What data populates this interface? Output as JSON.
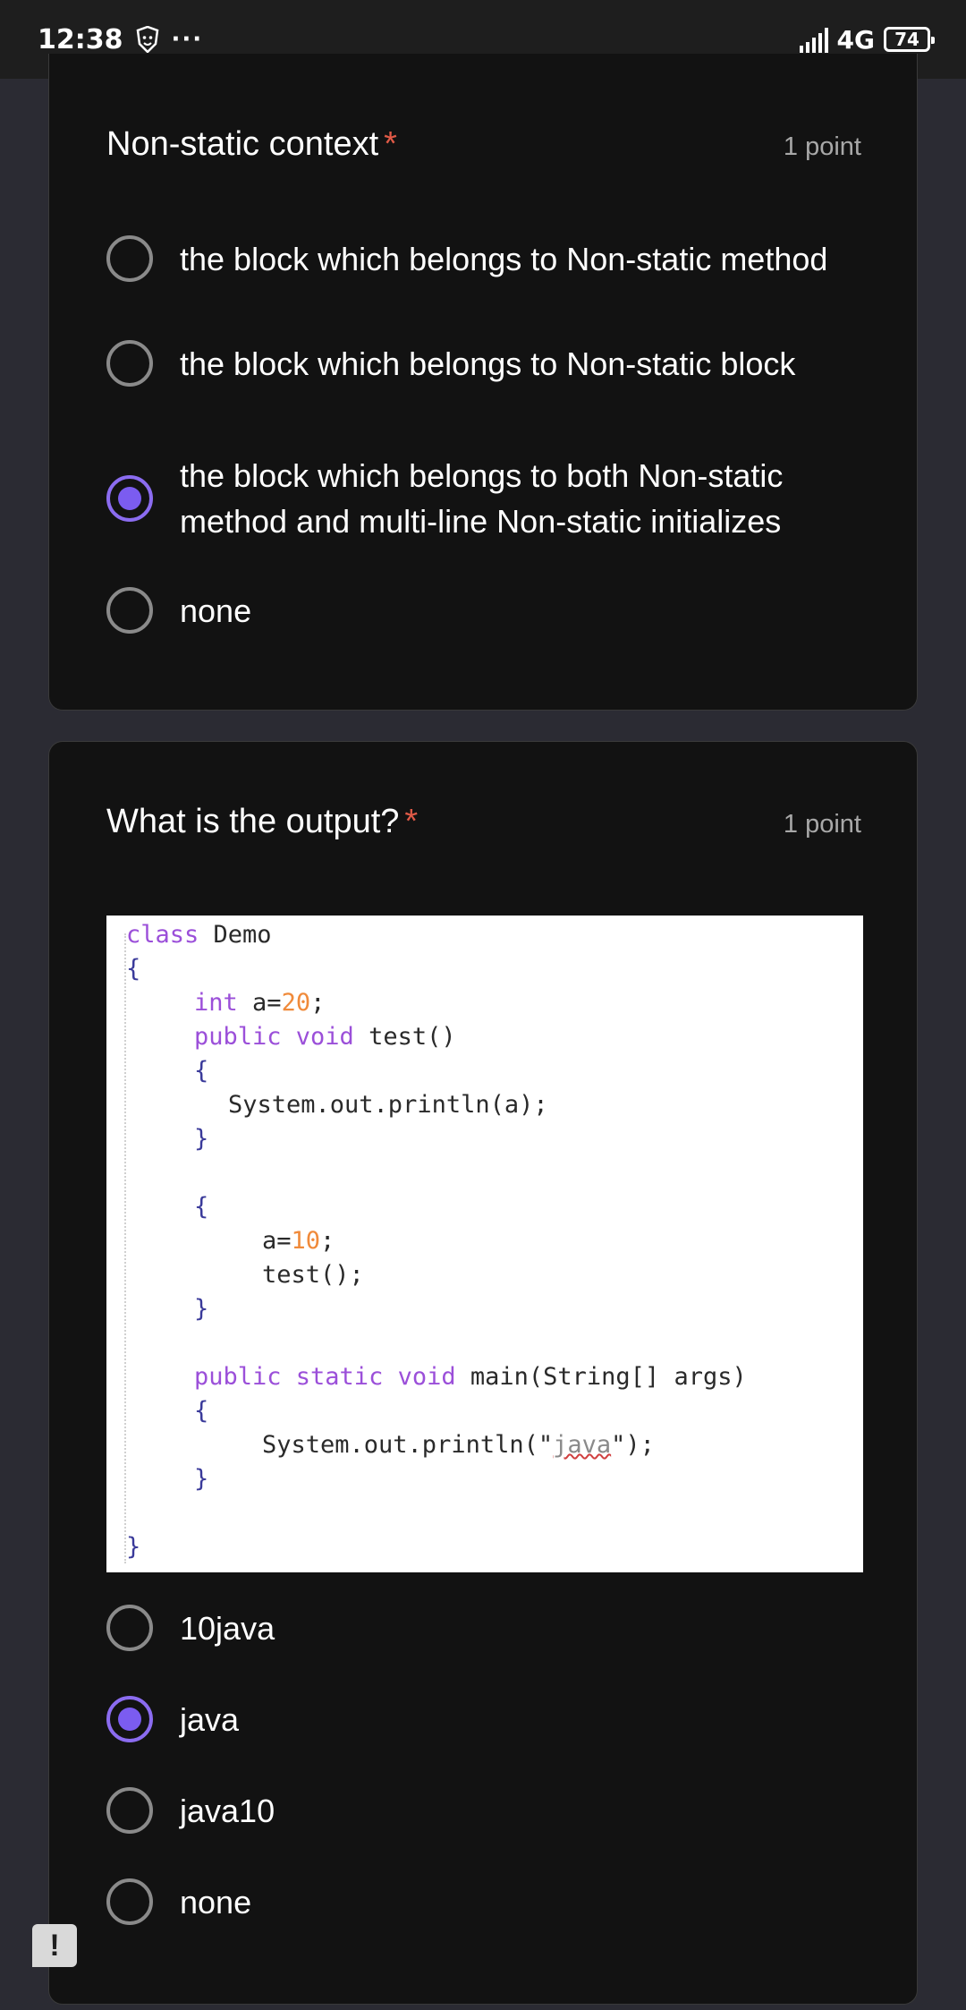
{
  "status_bar": {
    "time": "12:38",
    "dots": "···",
    "network": "4G",
    "battery": "74"
  },
  "questions": [
    {
      "title": "Non-static context",
      "required_mark": "*",
      "points": "1 point",
      "options": [
        {
          "label": "the block which belongs to Non-static method",
          "checked": false
        },
        {
          "label": "the block which belongs to Non-static block",
          "checked": false
        },
        {
          "label": "the block which belongs to both Non-static method and multi-line Non-static initializes",
          "checked": true
        },
        {
          "label": "none",
          "checked": false
        }
      ]
    },
    {
      "title": "What is the output?",
      "required_mark": "*",
      "points": "1 point",
      "code": {
        "l1_kw": "class",
        "l1_rest": " Demo",
        "l2": "{",
        "l3_kw": "int",
        "l3_a": " a=",
        "l3_num": "20",
        "l3_end": ";",
        "l4_kw": "public void",
        "l4_rest": " test()",
        "l5": "{",
        "l6": "System.out.println(a);",
        "l7": "}",
        "l8": "{",
        "l9_a": "a=",
        "l9_num": "10",
        "l9_end": ";",
        "l10": "test();",
        "l11": "}",
        "l12_kw": "public static void",
        "l12_rest": " main(String[] args)",
        "l13": "{",
        "l14_a": "System.out.println(\"",
        "l14_str": "java",
        "l14_end": "\");",
        "l15": "}",
        "l16": "}"
      },
      "options": [
        {
          "label": "10java",
          "checked": false
        },
        {
          "label": "java",
          "checked": true
        },
        {
          "label": "java10",
          "checked": false
        },
        {
          "label": "none",
          "checked": false
        }
      ]
    }
  ],
  "feedback_button": "!",
  "colors": {
    "accent": "#7b5cf0",
    "required": "#e05a47",
    "card_bg": "#121212",
    "page_bg": "#2b2b33"
  }
}
